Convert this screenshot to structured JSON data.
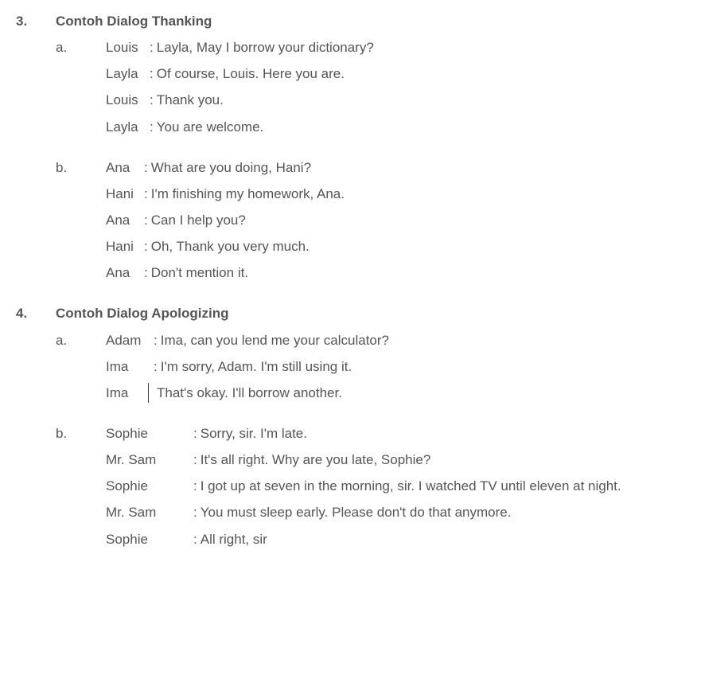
{
  "sections": [
    {
      "num": "3.",
      "title": "Contoh Dialog Thanking",
      "subs": [
        {
          "letter": "a.",
          "speakerWidthClass": "w55",
          "lines": [
            {
              "speaker": "Louis",
              "text": "Layla, May I borrow your dictionary?"
            },
            {
              "speaker": "Layla",
              "text": "Of course, Louis. Here you are."
            },
            {
              "speaker": "Louis",
              "text": "Thank you."
            },
            {
              "speaker": "Layla",
              "text": "You are welcome."
            }
          ]
        },
        {
          "letter": "b.",
          "speakerWidthClass": "w48",
          "lines": [
            {
              "speaker": "Ana",
              "text": "What are you doing, Hani?"
            },
            {
              "speaker": "Hani",
              "text": "I'm finishing my homework, Ana."
            },
            {
              "speaker": "Ana",
              "text": "Can I help you?"
            },
            {
              "speaker": "Hani",
              "text": "Oh, Thank you very much."
            },
            {
              "speaker": "Ana",
              "text": "Don't mention it."
            }
          ]
        }
      ]
    },
    {
      "num": "4.",
      "title": "Contoh Dialog Apologizing",
      "subs": [
        {
          "letter": "a.",
          "speakerWidthClass": "w60",
          "lines": [
            {
              "speaker": "Adam",
              "text": "Ima, can you lend me your calculator?"
            },
            {
              "speaker": "Ima",
              "text": "I'm sorry, Adam. I'm still using it."
            },
            {
              "speaker": "Ima",
              "text": "That's okay. I'll borrow another.",
              "cursor": true
            }
          ]
        },
        {
          "letter": "b.",
          "speakerWidthClass": "w110",
          "lines": [
            {
              "speaker": "Sophie",
              "text": "Sorry, sir. I'm late."
            },
            {
              "speaker": "Mr. Sam",
              "text": "It's all right. Why are you late, Sophie?"
            },
            {
              "speaker": "Sophie",
              "text": "I got up at seven in the morning, sir. I watched TV until eleven at night."
            },
            {
              "speaker": "Mr. Sam",
              "text": "You must sleep early. Please don't do that anymore."
            },
            {
              "speaker": "Sophie",
              "text": "All right, sir"
            }
          ]
        }
      ]
    }
  ]
}
